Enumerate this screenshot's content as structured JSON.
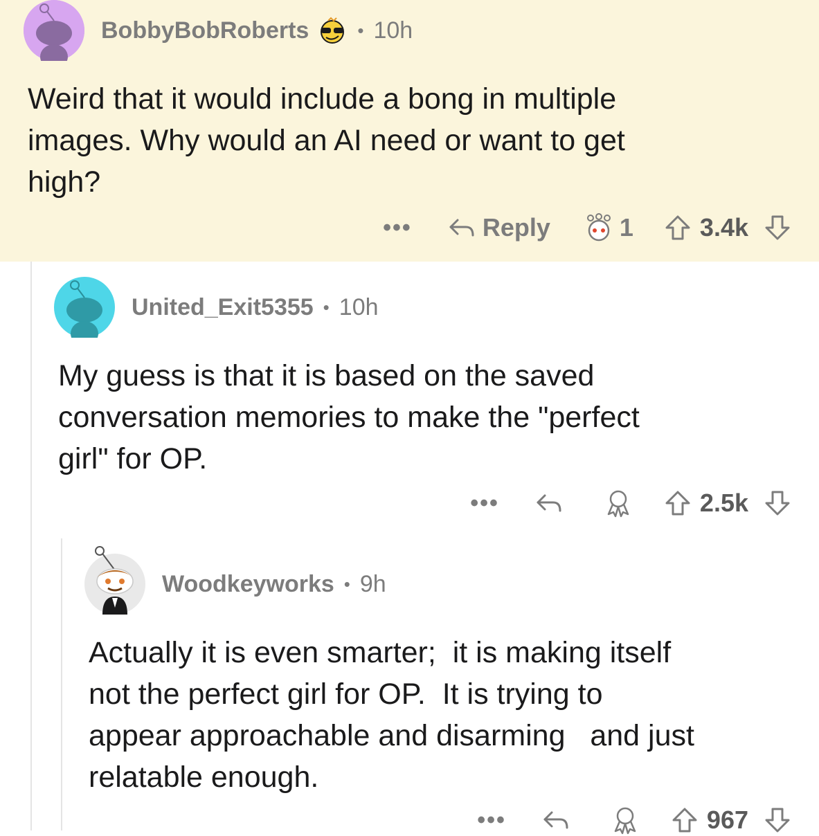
{
  "comments": [
    {
      "username": "BobbyBobRoberts",
      "flair_icon": "sunglasses-emoji-icon",
      "time": "10h",
      "body": "Weird that it would include a bong in multiple\nimages. Why would an AI need or want to get\nhigh?",
      "more_label": "•••",
      "reply_label": "Reply",
      "award_count": "1",
      "score": "3.4k",
      "avatar_color": "#d7a6f0",
      "highlight_bg": "#fbf5dc"
    },
    {
      "username": "United_Exit5355",
      "time": "10h",
      "body": "My guess is that it is based on the saved\nconversation memories to make the \"perfect\ngirl\" for OP.",
      "more_label": "•••",
      "score": "2.5k",
      "avatar_color": "#4ed6e8"
    },
    {
      "username": "Woodkeyworks",
      "time": "9h",
      "body": "Actually it is even smarter;  it is making itself\nnot the perfect girl for OP.  It is trying to\nappear approachable and disarming   and just\nrelatable enough.",
      "more_label": "•••",
      "score": "967",
      "avatar_color": "#e9e9e9"
    }
  ],
  "separator": "•"
}
